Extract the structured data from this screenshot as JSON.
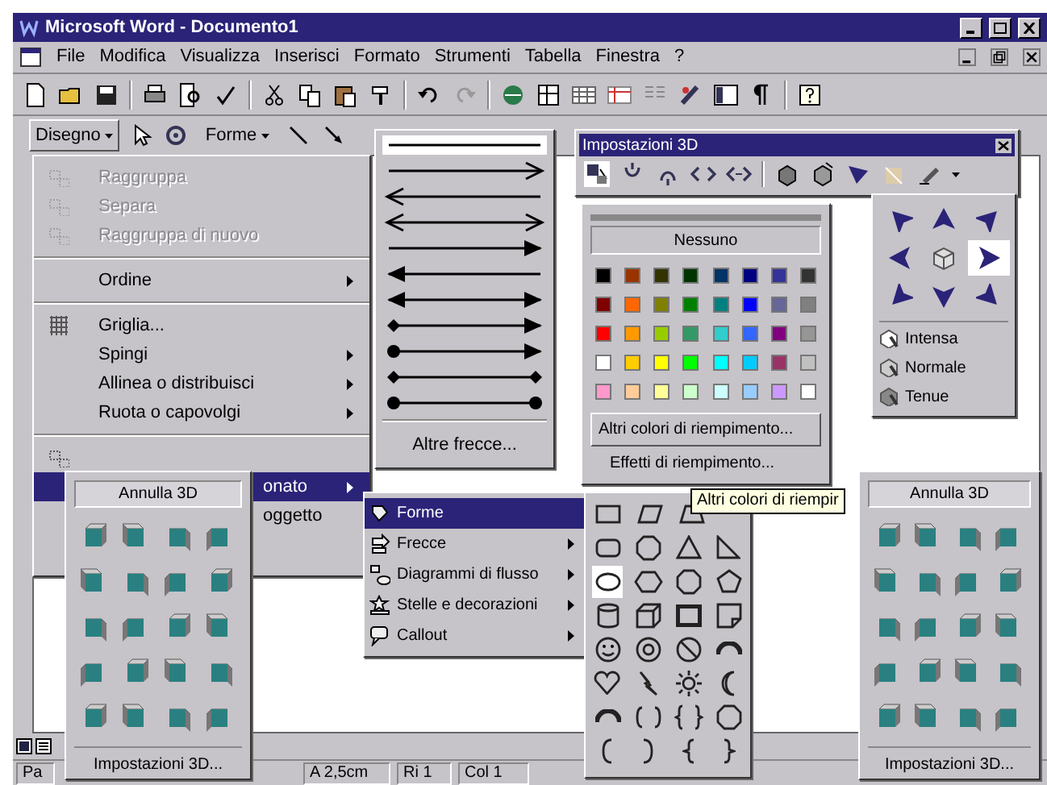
{
  "window": {
    "title": "Microsoft Word - Documento1"
  },
  "menu_bar": [
    "File",
    "Modifica",
    "Visualizza",
    "Inserisci",
    "Formato",
    "Strumenti",
    "Tabella",
    "Finestra",
    "?"
  ],
  "drawing_toolbar": {
    "draw_button": "Disegno",
    "shapes_button": "Forme"
  },
  "draw_menu": {
    "groups": [
      [
        {
          "label": "Raggruppa",
          "disabled": true,
          "submenu": false,
          "selected": false
        },
        {
          "label": "Separa",
          "disabled": true,
          "submenu": false,
          "selected": false
        },
        {
          "label": "Raggruppa di nuovo",
          "disabled": true,
          "submenu": false,
          "selected": false
        }
      ],
      [
        {
          "label": "Ordine",
          "disabled": false,
          "submenu": true,
          "selected": false
        }
      ],
      [
        {
          "label": "Griglia...",
          "disabled": false,
          "submenu": false,
          "selected": false
        },
        {
          "label": "Spingi",
          "disabled": false,
          "submenu": true,
          "selected": false
        },
        {
          "label": "Allinea o distribuisci",
          "disabled": false,
          "submenu": true,
          "selected": false
        },
        {
          "label": "Ruota o capovolgi",
          "disabled": false,
          "submenu": true,
          "selected": false
        }
      ],
      [
        {
          "disabled": false,
          "submenu": false,
          "selected": false
        },
        {
          "label": "onato",
          "disabled": false,
          "submenu": true,
          "selected": true
        },
        {
          "label": "oggetto",
          "disabled": false,
          "submenu": false,
          "selected": false
        }
      ]
    ]
  },
  "arrow_menu": {
    "more": "Altre frecce..."
  },
  "toolbar_3d": {
    "title": "Impostazioni 3D"
  },
  "fill_menu": {
    "none": "Nessuno",
    "swatches": [
      [
        {
          "color": "#000000"
        },
        {
          "color": "#993300"
        },
        {
          "color": "#333300"
        },
        {
          "color": "#003300"
        },
        {
          "color": "#003366"
        },
        {
          "color": "#000080"
        },
        {
          "color": "#333399"
        },
        {
          "color": "#333333"
        }
      ],
      [
        {
          "color": "#800000"
        },
        {
          "color": "#ff6600"
        },
        {
          "color": "#808000"
        },
        {
          "color": "#008000"
        },
        {
          "color": "#008080"
        },
        {
          "color": "#0000ff"
        },
        {
          "color": "#666699"
        },
        {
          "color": "#808080"
        }
      ],
      [
        {
          "color": "#ff0000"
        },
        {
          "color": "#ff9900"
        },
        {
          "color": "#99cc00"
        },
        {
          "color": "#339966"
        },
        {
          "color": "#33cccc"
        },
        {
          "color": "#3366ff"
        },
        {
          "color": "#800080"
        },
        {
          "color": "#969696"
        }
      ],
      [
        {
          "color": "#ffffff"
        },
        {
          "color": "#ffcc00"
        },
        {
          "color": "#ffff00"
        },
        {
          "color": "#00ff00"
        },
        {
          "color": "#00ffff"
        },
        {
          "color": "#00ccff"
        },
        {
          "color": "#993366"
        },
        {
          "color": "#c0c0c0"
        }
      ],
      [
        {
          "color": "#ff99cc"
        },
        {
          "color": "#ffcc99"
        },
        {
          "color": "#ffff99"
        },
        {
          "color": "#ccffcc"
        },
        {
          "color": "#ccffff"
        },
        {
          "color": "#99ccff"
        },
        {
          "color": "#cc99ff"
        },
        {
          "color": "#ffffff"
        }
      ]
    ],
    "items": [
      "Altri colori di riempimento...",
      "Effetti di riempimento..."
    ]
  },
  "tooltip": "Altri colori di riempir",
  "direction_menu": {
    "directions": [
      {
        "selected": false
      },
      {
        "selected": false
      },
      {
        "selected": false
      },
      {
        "selected": false
      },
      {
        "selected": false
      },
      {
        "selected": true
      },
      {
        "selected": false
      },
      {
        "selected": false
      },
      {
        "selected": false
      }
    ],
    "lighting": [
      {
        "label": "Intensa"
      },
      {
        "label": "Normale"
      },
      {
        "label": "Tenue"
      }
    ]
  },
  "shapes_submenu": [
    {
      "label": "Forme",
      "submenu": false,
      "selected": true
    },
    {
      "label": "Frecce",
      "submenu": true,
      "selected": false
    },
    {
      "label": "Diagrammi di flusso",
      "submenu": true,
      "selected": false
    },
    {
      "label": "Stelle e decorazioni",
      "submenu": true,
      "selected": false
    },
    {
      "label": "Callout",
      "submenu": true,
      "selected": false
    }
  ],
  "shapes_palette": [
    [
      {
        "kind": "rect",
        "selected": false
      },
      {
        "kind": "parallelogram",
        "selected": false
      },
      {
        "kind": "trapezoid",
        "selected": false
      }
    ],
    [
      {
        "kind": "rounded",
        "selected": false
      },
      {
        "kind": "octagon",
        "selected": false
      },
      {
        "kind": "triangle",
        "selected": false
      },
      {
        "kind": "righttriangle",
        "selected": false
      }
    ],
    [
      {
        "kind": "ellipse",
        "selected": true
      },
      {
        "kind": "hexagon",
        "selected": false
      },
      {
        "kind": "octagon",
        "selected": false
      },
      {
        "kind": "pentagon",
        "selected": false
      }
    ],
    [
      {
        "kind": "cylinder",
        "selected": false
      },
      {
        "kind": "cube",
        "selected": false
      },
      {
        "kind": "frame",
        "selected": false
      },
      {
        "kind": "folded",
        "selected": false
      }
    ],
    [
      {
        "kind": "smiley",
        "selected": false
      },
      {
        "kind": "donut",
        "selected": false
      },
      {
        "kind": "nosymbol",
        "selected": false
      },
      {
        "kind": "arc",
        "selected": false
      }
    ],
    [
      {
        "kind": "heart",
        "selected": false
      },
      {
        "kind": "lightning",
        "selected": false
      },
      {
        "kind": "sun",
        "selected": false
      },
      {
        "kind": "moon",
        "selected": false
      }
    ],
    [
      {
        "kind": "arc",
        "selected": false
      },
      {
        "kind": "bracketpair",
        "selected": false
      },
      {
        "kind": "bracepair",
        "selected": false
      },
      {
        "kind": "octagon",
        "selected": false
      }
    ],
    [
      {
        "kind": "lbracket",
        "selected": false
      },
      {
        "kind": "rbracket",
        "selected": false
      },
      {
        "kind": "lbrace",
        "selected": false
      },
      {
        "kind": "rbrace",
        "selected": false
      }
    ]
  ],
  "palettes_3d": [
    {
      "reset": "Annulla 3D",
      "settings": "Impostazioni 3D..."
    },
    {
      "reset": "Annulla 3D",
      "settings": "Impostazioni 3D..."
    }
  ],
  "status_bar": [
    "Pa",
    "A 2,5cm",
    "Ri 1",
    "Col 1"
  ]
}
